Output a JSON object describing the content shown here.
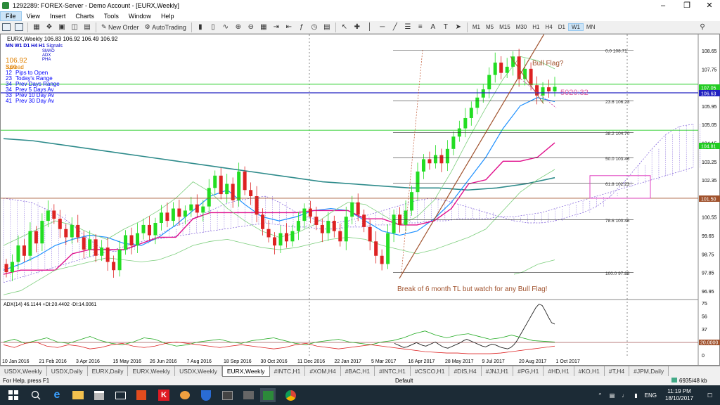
{
  "window": {
    "title": "1292289: FOREX-Server - Demo Account - [EURX,Weekly]"
  },
  "menu": [
    "File",
    "View",
    "Insert",
    "Charts",
    "Tools",
    "Window",
    "Help"
  ],
  "toolbar": {
    "new_order": "New Order",
    "autotrading": "AutoTrading",
    "timeframes": [
      "M1",
      "M5",
      "M15",
      "M30",
      "H1",
      "H4",
      "D1",
      "W1",
      "MN"
    ]
  },
  "chart": {
    "header": "EURX,Weekly  106.83 106.92 106.49 106.92",
    "timeframes_label": "MN W1 D1  H4  H1",
    "signals_label": "Signals",
    "small_labels": [
      "SMAO",
      "ADX",
      "PHA"
    ],
    "price_big": "106.92",
    "annotations": {
      "bull_flag": "Bull Flag?",
      "countdown": "5020:32",
      "bottom": "Break of 6 month TL but watch for any Bull Flag!"
    },
    "indicator_lines": [
      {
        "num": "3.00",
        "text": "Spread",
        "color": "#e08000"
      },
      {
        "num": "12",
        "text": "Pips to Open",
        "color": "#0000ff"
      },
      {
        "num": "23",
        "text": "Today's Range",
        "color": "#0000ff"
      },
      {
        "num": "34",
        "text": "Prev Days Range",
        "color": "#0000ff"
      },
      {
        "num": "34",
        "text": "Prev 5 Days Av",
        "color": "#0000ff"
      },
      {
        "num": "33",
        "text": "Prev 10 Day Av",
        "color": "#0000ff"
      },
      {
        "num": "41",
        "text": "Prev 30 Day Av",
        "color": "#0000ff"
      }
    ],
    "price_axis": [
      "108.65",
      "107.75",
      "106.85",
      "105.95",
      "105.05",
      "104.15",
      "103.25",
      "102.35",
      "101.50",
      "100.55",
      "99.65",
      "98.75",
      "97.85",
      "96.95"
    ],
    "price_tags": [
      {
        "label": "107.05",
        "color": "#22cc22"
      },
      {
        "label": "106.63",
        "color": "#2020c0"
      },
      {
        "label": "104.81",
        "color": "#22cc22"
      },
      {
        "label": "101.50",
        "color": "#a0522d"
      }
    ],
    "fib": [
      {
        "label": "0.0  108.71"
      },
      {
        "label": "23.6  106.23"
      },
      {
        "label": "38.2  104.70"
      },
      {
        "label": "50.0  103.46"
      },
      {
        "label": "61.8  102.23"
      },
      {
        "label": "78.6  100.46"
      },
      {
        "label": "100.0  97.88"
      }
    ],
    "adx_label": "ADX(14) 46.1144 +DI:20.4402 -DI:14.0061",
    "adx_axis": [
      "75",
      "56",
      "37",
      "19",
      "0"
    ],
    "adx_tag": "20.0000",
    "date_axis": [
      "10 Jan 2016",
      "21 Feb 2016",
      "3 Apr 2016",
      "15 May 2016",
      "26 Jun 2016",
      "7 Aug 2016",
      "18 Sep 2016",
      "30 Oct 2016",
      "11 Dec 2016",
      "22 Jan 2017",
      "5 Mar 2017",
      "16 Apr 2017",
      "28 May 2017",
      "9 Jul 2017",
      "20 Aug 2017",
      "1 Oct 2017"
    ]
  },
  "tabs": [
    "USDX,Weekly",
    "USDX,Daily",
    "EURX,Daily",
    "EURX,Weekly",
    "USDX,Weekly",
    "EURX,Weekly",
    "#INTC,H1",
    "#XOM,H4",
    "#BAC,H1",
    "#INTC,H1",
    "#CSCO,H1",
    "#DIS,H4",
    "#JNJ,H1",
    "#PG,H1",
    "#HD,H1",
    "#KO,H1",
    "#T,H4",
    "#JPM,Daily"
  ],
  "active_tab": 5,
  "status": {
    "help": "For Help, press F1",
    "profile": "Default",
    "traffic": "6935/48 kb"
  },
  "taskbar": {
    "lang": "ENG",
    "time": "11:19 PM",
    "date": "18/10/2017"
  },
  "colors": {
    "bull": "#22dd22",
    "bear": "#dd2222",
    "cloud": "#7b5ad8",
    "trendline": "#a0522d"
  }
}
